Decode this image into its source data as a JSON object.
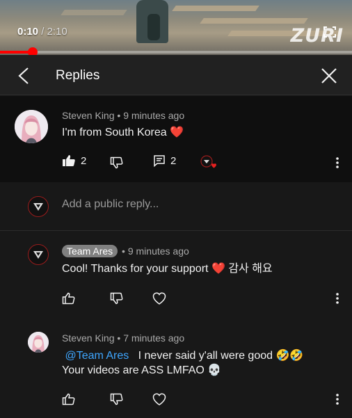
{
  "player": {
    "current_time": "0:10",
    "separator": " / ",
    "duration": "2:10",
    "watermark": "ZURI",
    "progress_fraction": 0.092
  },
  "header": {
    "title": "Replies"
  },
  "parent_comment": {
    "author": "Steven King",
    "time": "9 minutes ago",
    "text": "I'm from South Korea",
    "emoji": "❤️",
    "likes": "2",
    "replies": "2"
  },
  "reply_input": {
    "placeholder": "Add a public reply..."
  },
  "replies": [
    {
      "author": "Team Ares",
      "time": "9 minutes ago",
      "text": "Cool! Thanks for your support",
      "emoji": "❤️",
      "suffix": "감사 해요"
    },
    {
      "author": "Steven King",
      "time": "7 minutes ago",
      "mention": "@Team Ares",
      "line1": "I never said y'all were good",
      "line1_emoji": "🤣🤣",
      "line2": "Your videos are ASS LMFAO",
      "line2_emoji": "💀"
    }
  ],
  "meta_separator": " • ",
  "colors": {
    "background": "#181818",
    "highlight": "#0f0f0f",
    "accent_red": "#ff0000",
    "mention_blue": "#3ea6ff"
  }
}
